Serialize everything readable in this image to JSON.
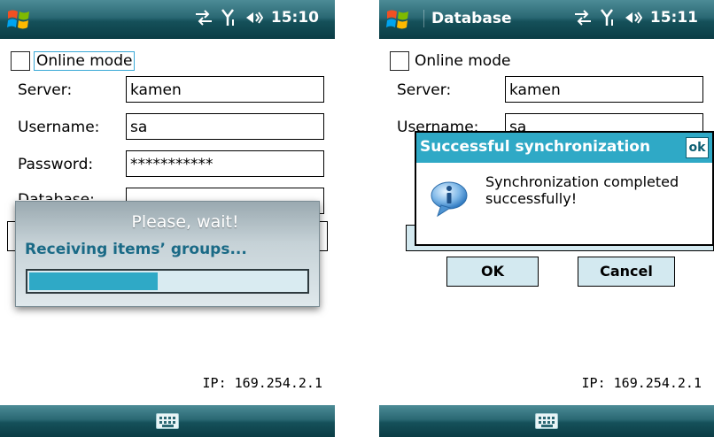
{
  "left": {
    "status": {
      "clock": "15:10"
    },
    "form": {
      "online_mode_label": "Online mode",
      "server_label": "Server:",
      "server_value": "kamen",
      "username_label": "Username:",
      "username_value": "sa",
      "password_label": "Password:",
      "password_value": "***********"
    },
    "wait_dialog": {
      "title": "Please, wait!",
      "message": "Receiving items’ groups...",
      "progress": 0.47
    },
    "ip": "IP: 169.254.2.1"
  },
  "right": {
    "status": {
      "app_name": "Database",
      "clock": "15:11"
    },
    "form": {
      "online_mode_label": "Online mode",
      "server_label": "Server:",
      "server_value": "kamen",
      "username_label": "Username:",
      "username_value": "sa"
    },
    "sync_dialog": {
      "title": "Successful synchronization",
      "ok_label": "ok",
      "message": "Synchronization completed successfully!"
    },
    "buttons": {
      "ok": "OK",
      "cancel": "Cancel"
    },
    "ip": "IP: 169.254.2.1"
  },
  "colors": {
    "accent": "#2fa9c6",
    "titlebar": "#1f5d68",
    "wait_text": "#1a6a86"
  },
  "icons": [
    "windows-start-icon",
    "connectivity-icon",
    "signal-icon",
    "volume-icon",
    "keyboard-icon",
    "info-icon"
  ]
}
